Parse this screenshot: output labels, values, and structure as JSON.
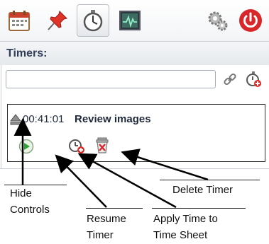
{
  "toolbar": {
    "buttons": [
      {
        "icon": "calendar-icon"
      },
      {
        "icon": "pin-icon"
      },
      {
        "icon": "stopwatch-icon"
      },
      {
        "icon": "activity-monitor-icon"
      },
      {
        "icon": "gears-icon"
      },
      {
        "icon": "power-icon"
      }
    ]
  },
  "timers": {
    "heading": "Timers:",
    "input_value": "",
    "actions": [
      "link-icon",
      "add-timer-icon"
    ]
  },
  "timer": {
    "time": "00:41:01",
    "name": "Review images",
    "controls": [
      "hide-controls-icon",
      "resume-icon",
      "apply-time-icon",
      "delete-icon"
    ]
  },
  "annotations": {
    "hide_controls_1": "Hide",
    "hide_controls_2": "Controls",
    "resume_timer_1": "Resume",
    "resume_timer_2": "Timer",
    "apply_time_1": "Apply Time to",
    "apply_time_2": "Time Sheet",
    "delete_timer": "Delete Timer"
  },
  "colors": {
    "heading": "#2f3e56",
    "power": "#d8262a",
    "resume": "#2fa23a",
    "delete": "#d8262a"
  }
}
